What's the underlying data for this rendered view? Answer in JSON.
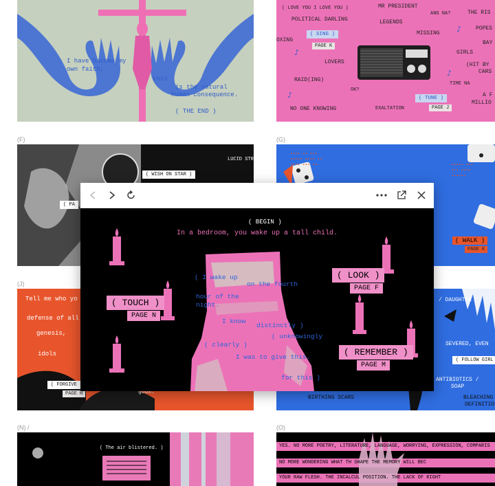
{
  "tiles": {
    "t1": {
      "lines": [
        "I have become my",
        "own faith,",
        "this",
        "is the natural",
        "human consequence."
      ],
      "end": "( THE END )"
    },
    "t2": {
      "words": [
        "( LOVE YOU I LOVE YOU )",
        "MR PRESIDENT",
        "ANG NA?",
        "THE RIS",
        "POLITICAL DARLING",
        "LEGENDS",
        "POPES",
        "OXING",
        "MISSING",
        "BAY",
        "GIRLS",
        "LOVERS",
        "(HIT BY",
        "CARS",
        "RAID(ING)",
        "TIME NA",
        "OK?",
        "A F",
        "MILLIO",
        "NO ONE KNOWING",
        "EXALTATION"
      ],
      "sing": "( SING )",
      "sing_page": "PAGE K",
      "tune": "( TUNE )",
      "tune_page": "PAGE J"
    },
    "f": {
      "label": "(F)",
      "lucid": "LUCID STR",
      "wish": "( WISH ON STAR )",
      "pa": "( PA"
    },
    "g": {
      "label": "(G)",
      "walk": "( WALK )",
      "walk_page": "PAGE K"
    },
    "j": {
      "label": "(J)",
      "lines": [
        "Tell me who yo",
        "defense of all a",
        "genesis,",
        "idols"
      ],
      "forgive": "( FORGIVE",
      "forgive_page": "PAGE H",
      "gods": "gods."
    },
    "k": {
      "daughter": "/ DAUGHTER",
      "severed": "SEVERED, EVEN",
      "follow": "( FOLLOW GIRL",
      "antibiotics": "ANTIBIOTICS /",
      "soap": "SOAP",
      "birthing": "BIRTHING SCARS",
      "bleaching": "BLEACHING",
      "definition": "DEFINITIO"
    },
    "n": {
      "label": "(N) /",
      "air": "( The air blistered. )"
    },
    "o": {
      "label": "(O)",
      "lines": [
        "YES. NO MORE POETRY, LITERATURE, LANGUAGE, WORRYING, EXPRESSION, COMPARIS",
        "NO MORE WONDERING WHAT TH                SHAPE THE MEMORY WILL BEC",
        "YOUR RAW FLESH. THE INCALCUL            POSITION. THE LACK OF RIGHT"
      ]
    }
  },
  "modal": {
    "begin": "( BEGIN )",
    "intro": "In a bedroom, you wake up a tall child.",
    "poem": [
      "( I wake up",
      "on the fourth",
      "hour of the",
      "night.",
      "I know",
      "distinctly )",
      "( unknowingly",
      "( clearly )",
      "I was to give this.",
      "for this )"
    ],
    "choices": {
      "touch": {
        "label": "( TOUCH )",
        "page": "PAGE N"
      },
      "look": {
        "label": "( LOOK )",
        "page": "PAGE F"
      },
      "remember": {
        "label": "( REMEMBER )",
        "page": "PAGE M"
      }
    }
  },
  "colors": {
    "pink": "#ef6fb4",
    "blue": "#2f6de0",
    "sage": "#c8d2c0",
    "orange": "#e8552c"
  }
}
